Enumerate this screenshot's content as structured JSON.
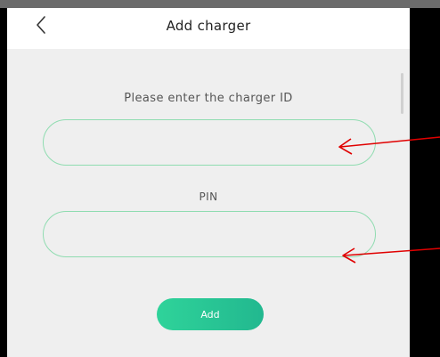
{
  "header": {
    "title": "Add charger",
    "back_icon": "chevron-left-icon"
  },
  "form": {
    "charger_id_label": "Please enter the charger ID",
    "charger_id_value": "",
    "pin_label": "PIN",
    "pin_value": "",
    "add_button_label": "Add"
  },
  "annotations": {
    "arrow_color": "#e00000",
    "arrow_icon": "red-arrow-annotation"
  },
  "colors": {
    "accent": "#2fd39a",
    "field_border": "#8fdcb0",
    "background": "#efefef"
  }
}
